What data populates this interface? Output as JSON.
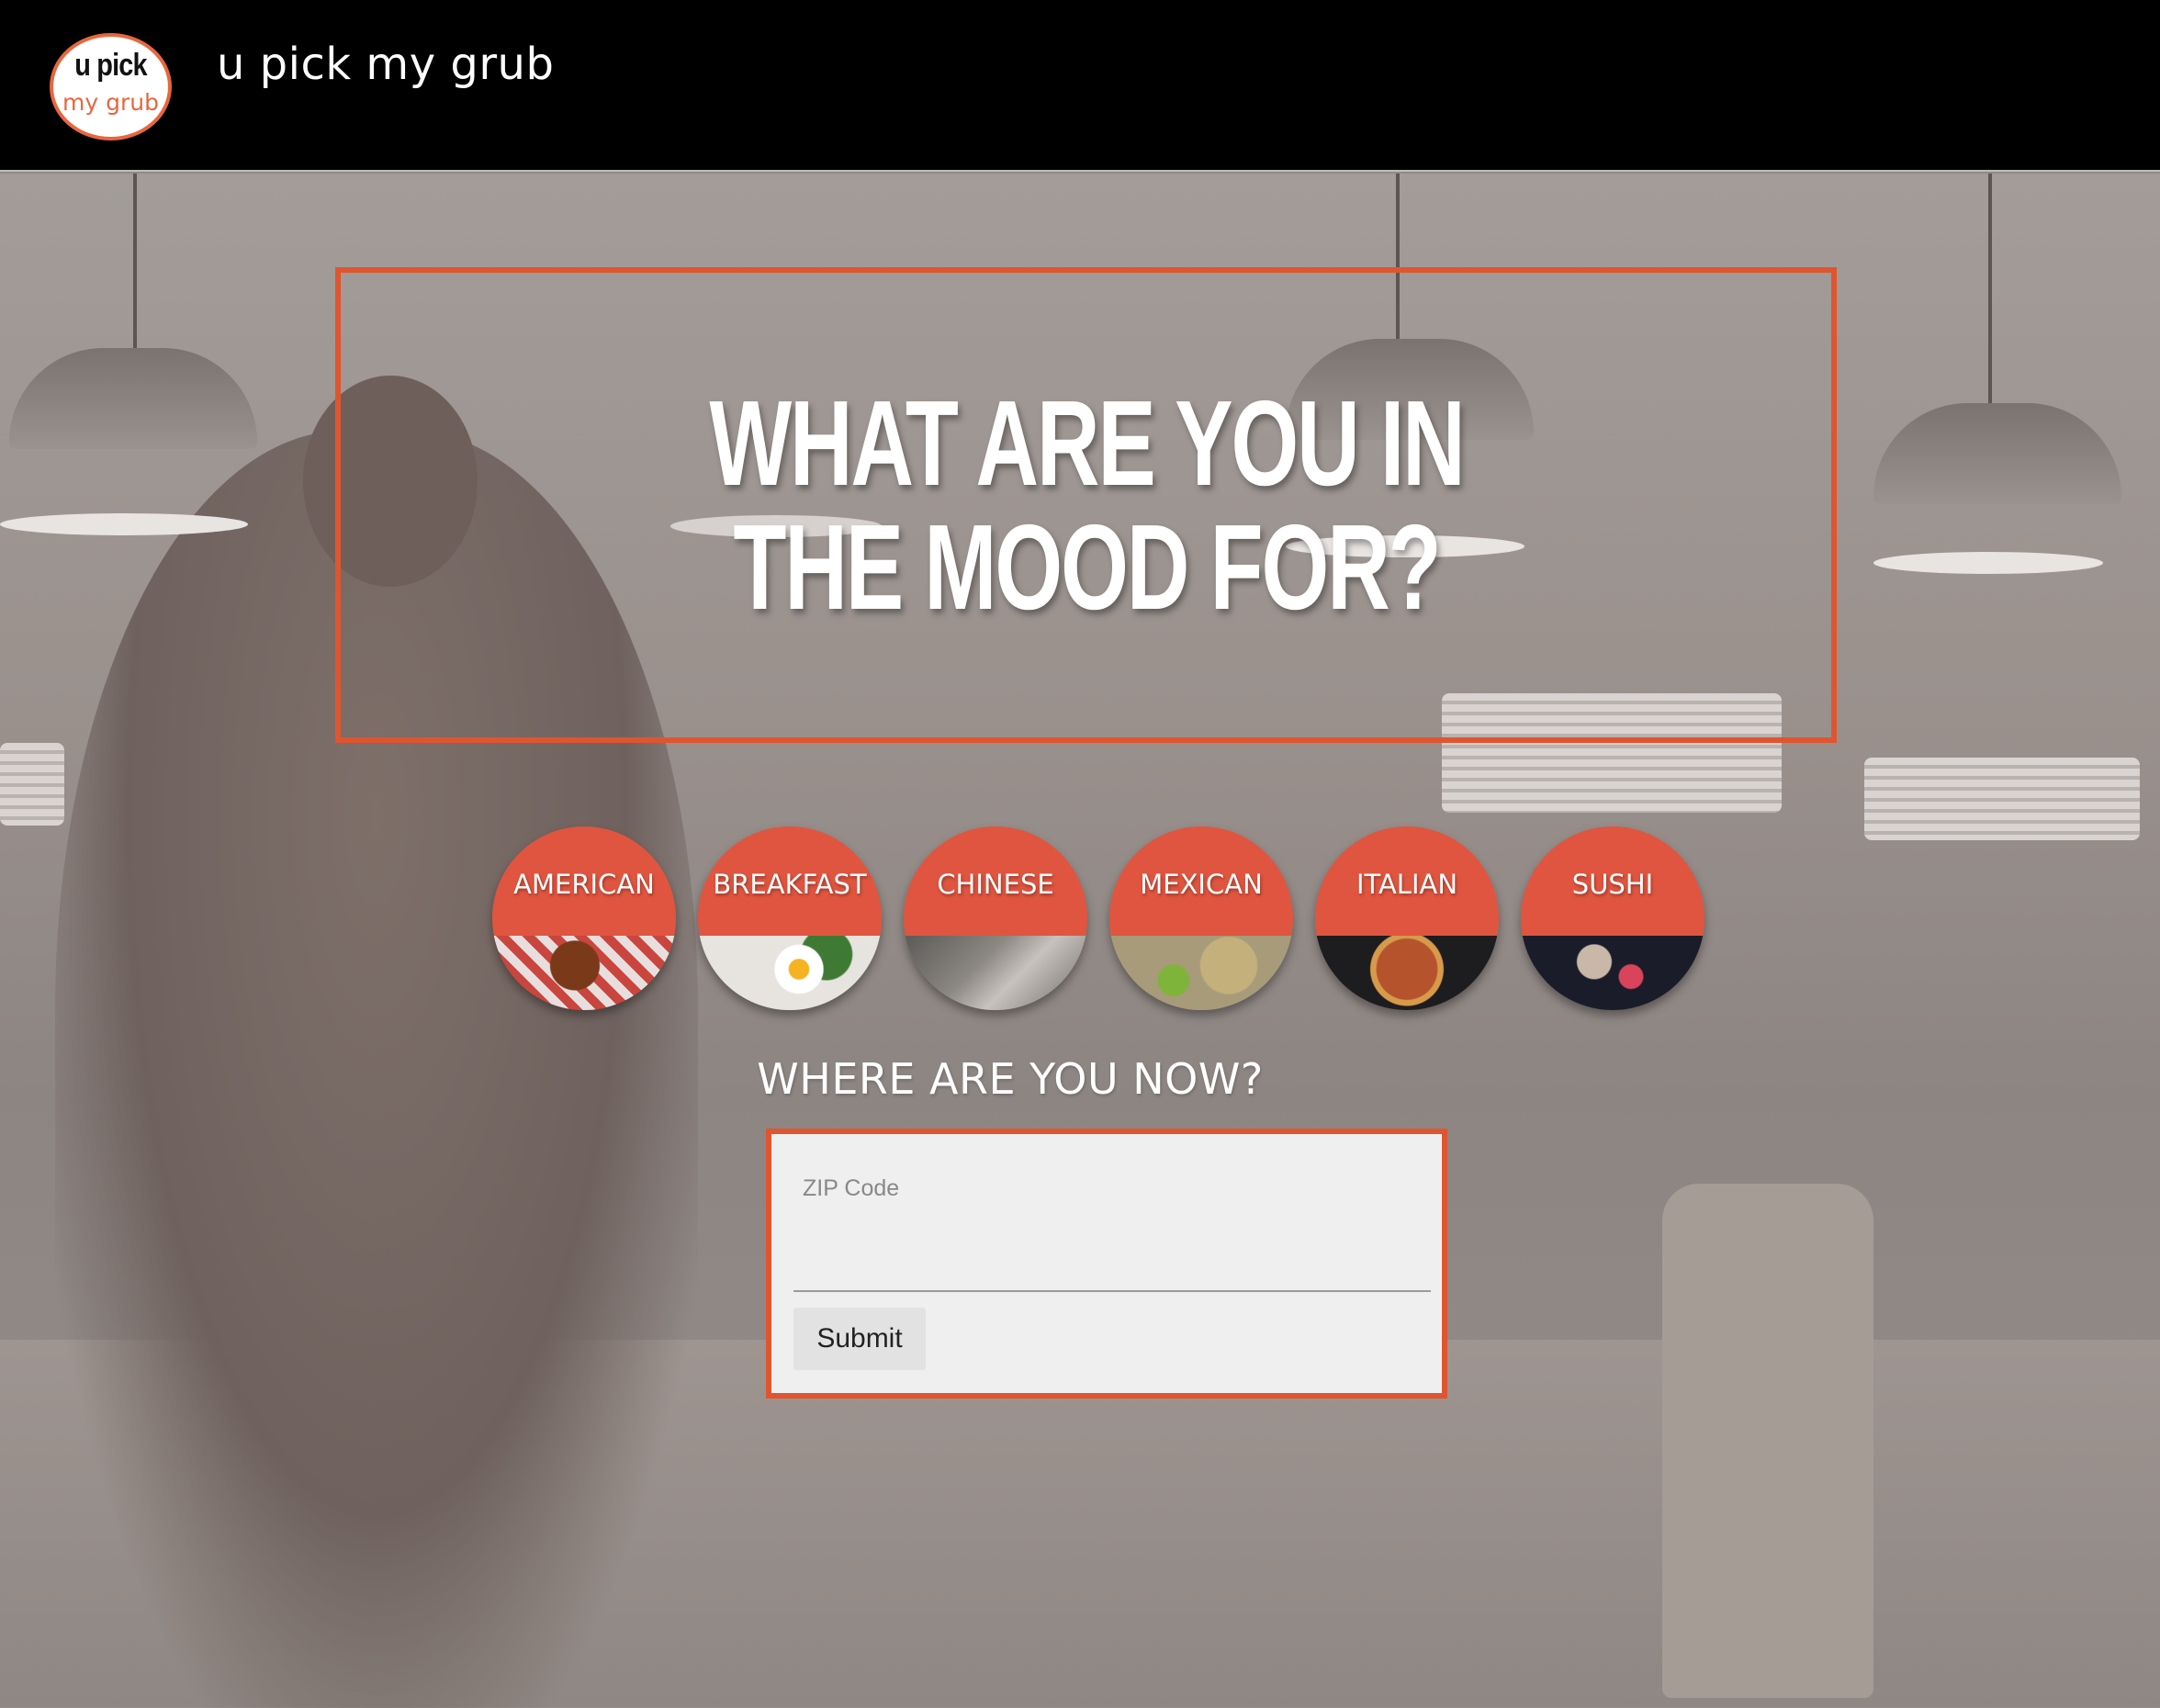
{
  "header": {
    "logo_line1": "u pick",
    "logo_line2": "my grub",
    "brand": "u pick my grub"
  },
  "hero": {
    "title": "WHAT ARE YOU IN THE MOOD FOR?"
  },
  "cuisines": [
    {
      "label": "AMERICAN"
    },
    {
      "label": "BREAKFAST"
    },
    {
      "label": "CHINESE"
    },
    {
      "label": "MEXICAN"
    },
    {
      "label": "ITALIAN"
    },
    {
      "label": "SUSHI"
    }
  ],
  "location": {
    "heading": "WHERE ARE YOU NOW?",
    "zip_label": "ZIP Code",
    "zip_value": "",
    "submit_label": "Submit"
  },
  "colors": {
    "accent": "#e0552f",
    "header_bg": "#000000",
    "form_bg": "#efefef"
  }
}
